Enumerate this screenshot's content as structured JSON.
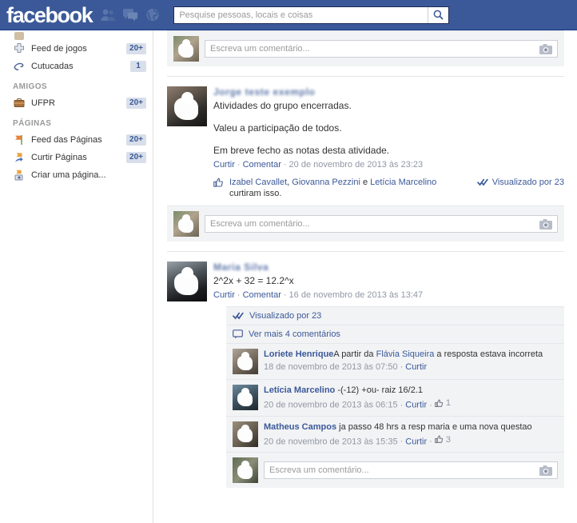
{
  "header": {
    "logo_text": "facebook",
    "icons": [
      "friend-requests-icon",
      "messages-icon",
      "notifications-globe-icon"
    ],
    "search": {
      "placeholder": "Pesquise pessoas, locais e coisas",
      "value": "",
      "button_icon": "search-icon"
    },
    "brand_color": "#3b5998"
  },
  "sidebar": {
    "groups": [
      {
        "title": "",
        "items": [
          {
            "label": "Feed de jogos",
            "badge": "20+",
            "icon": "games-feed-icon"
          },
          {
            "label": "Cutucadas",
            "badge": "1",
            "icon": "poke-icon"
          }
        ]
      },
      {
        "title": "AMIGOS",
        "items": [
          {
            "label": "UFPR",
            "badge": "20+",
            "icon": "briefcase-icon"
          }
        ]
      },
      {
        "title": "PÁGINAS",
        "items": [
          {
            "label": "Feed das Páginas",
            "badge": "20+",
            "icon": "pages-feed-flag-icon"
          },
          {
            "label": "Curtir Páginas",
            "badge": "20+",
            "icon": "like-pages-icon"
          },
          {
            "label": "Criar uma página...",
            "badge": "",
            "icon": "create-page-icon"
          }
        ]
      }
    ],
    "badge_bg": "#d8dfea",
    "badge_color": "#3b5998"
  },
  "feed": {
    "top_partial_post": {
      "composer_placeholder": "Escreva um comentário...",
      "camera_icon": "camera-icon"
    },
    "posts": [
      {
        "author": "Jorge teste exemplo",
        "author_redacted": true,
        "lines": [
          "Atividades do grupo encerradas.",
          "",
          "Valeu a participação de todos.",
          "",
          "Em breve fecho as notas desta atividade."
        ],
        "actions": {
          "like": "Curtir",
          "comment": "Comentar"
        },
        "timestamp": "20 de novembro de 2013 às 23:23",
        "likes": {
          "icon": "thumbs-up-icon",
          "names": [
            "Izabel Cavallet",
            "Giovanna Pezzini",
            "Letícia Marcelino"
          ],
          "conjunction": "e",
          "suffix": "curtiram isso."
        },
        "seen": {
          "icon": "double-check-icon",
          "label": "Visualizado por 23"
        },
        "bands": [],
        "comments": [],
        "composer_placeholder": "Escreva um comentário...",
        "camera_icon": "camera-icon"
      },
      {
        "author": "Maria Silva",
        "author_redacted": true,
        "lines": [
          "2^2x + 32 = 12.2^x"
        ],
        "actions": {
          "like": "Curtir",
          "comment": "Comentar"
        },
        "timestamp": "16 de novembro de 2013 às 13:47",
        "likes": null,
        "seen": null,
        "bands": [
          {
            "icon": "double-check-icon",
            "label": "Visualizado por 23"
          },
          {
            "icon": "comment-bubble-icon",
            "label": "Ver mais 4 comentários"
          }
        ],
        "comments": [
          {
            "author": "Loriete Henrique",
            "text_before": "A partir da ",
            "mention": "Flávia Siqueira",
            "text_after": " a resposta estava incorreta",
            "timestamp": "18 de novembro de 2013 às 07:50",
            "like_label": "Curtir",
            "like_count": ""
          },
          {
            "author": "Letícia Marcelino",
            "text_before": "-(-12) +ou- raiz 16/2.1",
            "mention": "",
            "text_after": "",
            "timestamp": "20 de novembro de 2013 às 06:15",
            "like_label": "Curtir",
            "like_count": "1"
          },
          {
            "author": "Matheus Campos",
            "text_before": "ja passo 48 hrs a resp maria e uma nova questao",
            "mention": "",
            "text_after": "",
            "timestamp": "20 de novembro de 2013 às 15:35",
            "like_label": "Curtir",
            "like_count": "3"
          }
        ],
        "composer_placeholder": "Escreva um comentário...",
        "camera_icon": "camera-icon"
      }
    ]
  }
}
